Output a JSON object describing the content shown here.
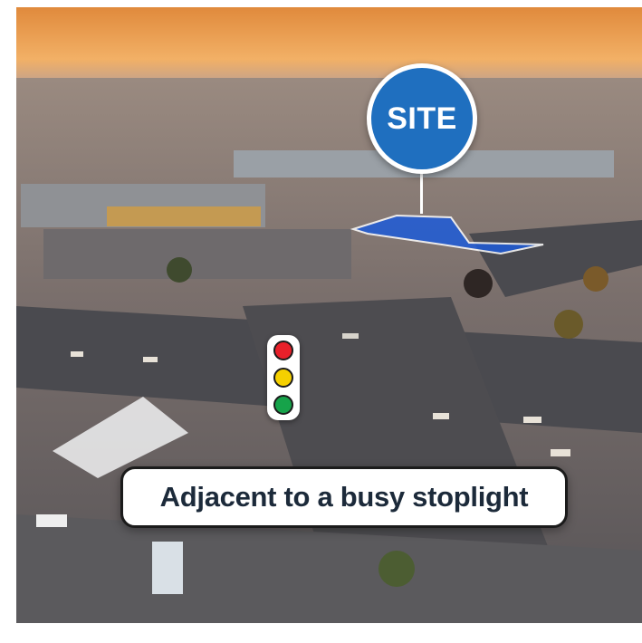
{
  "site_label": "SITE",
  "callout_text": "Adjacent to a busy stoplight",
  "stoplight": {
    "lamps": [
      "red",
      "yellow",
      "green"
    ]
  },
  "colors": {
    "site_pin": "#1f6fbf",
    "site_outline": "#1e5bd8",
    "callout_text": "#1c2a3a",
    "lamp_red": "#e8202a",
    "lamp_yellow": "#f5d000",
    "lamp_green": "#16a34a"
  }
}
